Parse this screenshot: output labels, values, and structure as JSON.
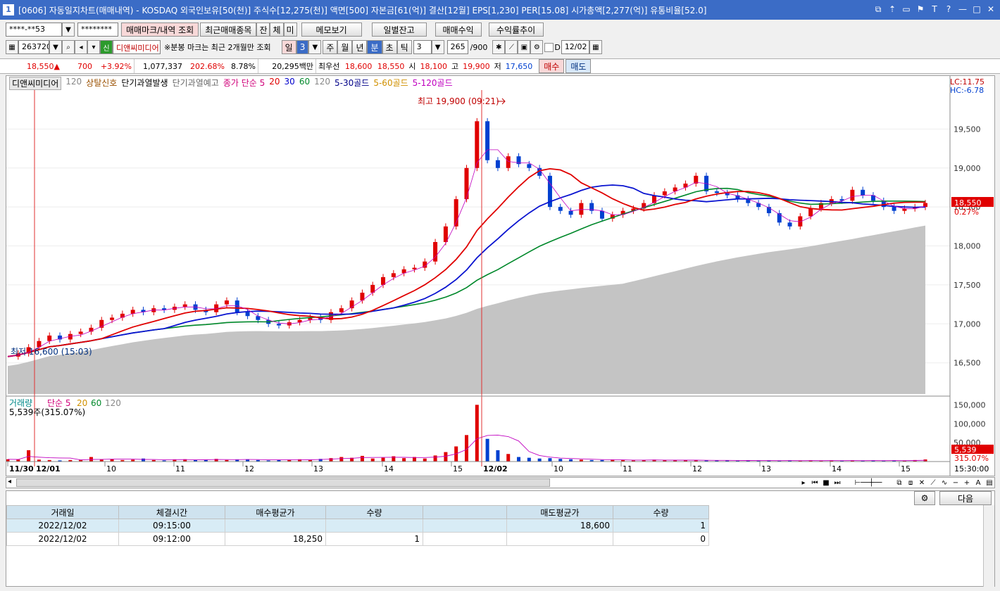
{
  "window": {
    "num": "1",
    "title": "[0606] 자동일지차트(매매내역) - KOSDAQ 외국인보유[50(천)] 주식수[12,275(천)] 액면[500] 자본금[61(억)] 결산[12월] EPS[1,230] PER[15.08] 시가총액[2,277(억)] 유통비율[52.0]"
  },
  "toolbar1": {
    "account": "****-**53",
    "password": "********",
    "btn_trade_mark": "매매마크/내역 조회",
    "btn_recent": "최근매매종목",
    "btn_jan": "잔",
    "btn_che": "체",
    "btn_mi": "미",
    "btn_memo": "메모보기",
    "btn_daily": "일별잔고",
    "btn_profit": "매매수익",
    "btn_yield": "수익률추이"
  },
  "toolbar2": {
    "code": "263720",
    "sin": "신",
    "name": "디앤씨미디어",
    "notice": "※분봉 마크는 최근 2개월만 조회",
    "period_il": "일",
    "period_value": "3",
    "period_ju": "주",
    "period_wol": "월",
    "period_nyeon": "년",
    "period_bun": "분",
    "period_cho": "초",
    "period_tik": "틱",
    "tick_value": "3",
    "count": "265",
    "count_total": "/900",
    "d_label": "D",
    "date": "12/02"
  },
  "quote": {
    "price": "18,550",
    "change": "700",
    "pct": "+3.92%",
    "volume": "1,077,337",
    "vol_pct": "202.68%",
    "turnover": "8.78%",
    "amount": "20,295백만",
    "best_label": "최우선",
    "ask": "18,600",
    "bid": "18,550",
    "open_label": "시",
    "open": "18,100",
    "high_label": "고",
    "high": "19,900",
    "low_label": "저",
    "low": "17,650",
    "btn_buy": "매수",
    "btn_sell": "매도"
  },
  "chart_legend": {
    "name": "디앤씨미디어",
    "n120": "120",
    "signal1": "상탈신호",
    "signal2": "단기과열발생",
    "signal3": "단기과열예고",
    "ma_label": "종가 단순 5",
    "ma20": "20",
    "ma30": "30",
    "ma60": "60",
    "ma120": "120",
    "gold1": "5-30골드",
    "gold2": "5-60골드",
    "gold3": "5-120골드",
    "lc": "LC:11.75",
    "hc": "HC:-6.78",
    "high_annot": "최고 19,900 (09:21)",
    "low_annot": "최저 16,600 (15:03)",
    "cur_price": "18,550",
    "cur_pct": "0.27%",
    "vol_legend": "거래량",
    "vol_ma": "단순 5",
    "vol20": "20",
    "vol60": "60",
    "vol120": "120",
    "vol_now": "5,539주(315.07%)",
    "vol_cur": "5,539",
    "vol_cur_pct": "315.07%",
    "time_last": "15:30:00"
  },
  "chart_data": {
    "type": "candlestick",
    "y_ticks": [
      "19,500",
      "19,000",
      "18,500",
      "18,000",
      "17,500",
      "17,000",
      "16,500"
    ],
    "ylim": [
      16100,
      20000
    ],
    "vol_ticks": [
      "150,000",
      "100,000",
      "50,000"
    ],
    "vol_ylim": [
      0,
      160000
    ],
    "x_labels": [
      "11/30",
      "12/01",
      "10",
      "11",
      "12",
      "13",
      "14",
      "15",
      "12/02",
      "10",
      "11",
      "12",
      "13",
      "14",
      "15"
    ],
    "price_path": [
      16580,
      16620,
      16700,
      16780,
      16850,
      16800,
      16870,
      16900,
      16950,
      17050,
      17080,
      17130,
      17180,
      17150,
      17200,
      17180,
      17220,
      17250,
      17180,
      17150,
      17250,
      17300,
      17150,
      17100,
      17050,
      17000,
      16980,
      17020,
      17050,
      17080,
      17050,
      17150,
      17200,
      17300,
      17400,
      17500,
      17600,
      17650,
      17700,
      17720,
      17800,
      18050,
      18250,
      18600,
      19000,
      19600,
      19100,
      19000,
      19150,
      19050,
      19000,
      18900,
      18500,
      18450,
      18400,
      18550,
      18450,
      18350,
      18400,
      18450,
      18480,
      18550,
      18650,
      18700,
      18750,
      18800,
      18900,
      18700,
      18680,
      18650,
      18600,
      18550,
      18500,
      18420,
      18300,
      18250,
      18380,
      18480,
      18550,
      18600,
      18580,
      18720,
      18650,
      18580,
      18500,
      18450,
      18480,
      18500,
      18550
    ],
    "low": 16600,
    "high": 19900,
    "vol_path": [
      6000,
      5000,
      30000,
      5000,
      4000,
      3000,
      4000,
      5000,
      12000,
      5000,
      6000,
      4000,
      5000,
      8000,
      4000,
      3000,
      5000,
      6000,
      4000,
      5000,
      7000,
      4000,
      5000,
      6000,
      4000,
      3000,
      4000,
      5000,
      6000,
      5000,
      7000,
      9000,
      12000,
      10000,
      15000,
      8000,
      10000,
      14000,
      9000,
      12000,
      8000,
      16000,
      25000,
      40000,
      70000,
      150000,
      60000,
      30000,
      20000,
      12000,
      10000,
      8000,
      9000,
      7000,
      6000,
      5000,
      4000,
      4000,
      5000,
      4000,
      3000,
      4000,
      5000,
      4000,
      3000,
      3000,
      4000,
      3000,
      3000,
      3000,
      2000,
      3000,
      2000,
      3000,
      2000,
      3000,
      2000,
      3000,
      2000,
      3000,
      2000,
      3000,
      2000,
      3000,
      2000,
      3000,
      2000,
      4000,
      5539
    ]
  },
  "grid": {
    "btn_next": "다음",
    "headers": [
      "거래일",
      "체결시간",
      "매수평균가",
      "수량",
      "",
      "매도평균가",
      "수량"
    ],
    "rows": [
      {
        "date": "2022/12/02",
        "time": "09:15:00",
        "buy_price": "",
        "buy_qty": "",
        "blank": "",
        "sell_price": "18,600",
        "sell_qty": "1"
      },
      {
        "date": "2022/12/02",
        "time": "09:12:00",
        "buy_price": "18,250",
        "buy_qty": "1",
        "blank": "",
        "sell_price": "",
        "sell_qty": "0"
      }
    ]
  }
}
